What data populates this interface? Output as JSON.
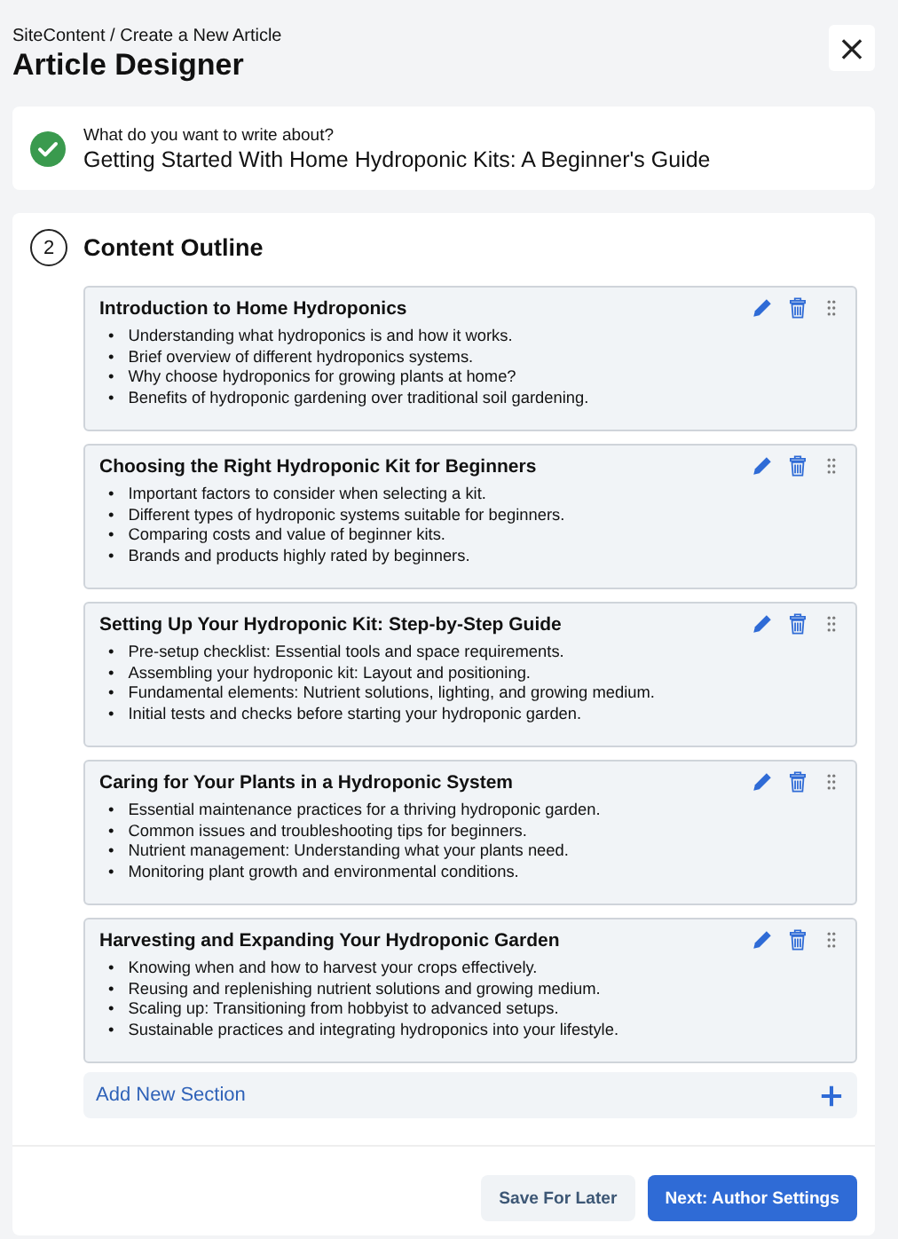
{
  "breadcrumb": "SiteContent / Create a New Article",
  "title": "Article Designer",
  "close_label": "×",
  "topic": {
    "done": true,
    "label": "What do you want to write about?",
    "value": "Getting Started With Home Hydroponic Kits: A Beginner's Guide"
  },
  "outline": {
    "step": "2",
    "title": "Content Outline",
    "sections": [
      {
        "title": "Introduction to Home Hydroponics",
        "points": [
          {
            "bullet": "•",
            "text": "Understanding what hydroponics is and how it works."
          },
          {
            "bullet": "•",
            "text": "Brief overview of different hydroponics systems."
          },
          {
            "bullet": "•",
            "text": "Why choose hydroponics for growing plants at home?"
          },
          {
            "bullet": "•",
            "text": "Benefits of hydroponic gardening over traditional soil gardening."
          }
        ]
      },
      {
        "title": "Choosing the Right Hydroponic Kit for Beginners",
        "points": [
          {
            "bullet": "•",
            "text": "Important factors to consider when selecting a kit."
          },
          {
            "bullet": "•",
            "text": "Different types of hydroponic systems suitable for beginners."
          },
          {
            "bullet": "•",
            "text": "Comparing costs and value of beginner kits."
          },
          {
            "bullet": "•",
            "text": "Brands and products highly rated by beginners."
          }
        ]
      },
      {
        "title": "Setting Up Your Hydroponic Kit: Step-by-Step Guide",
        "points": [
          {
            "bullet": "•",
            "text": "Pre-setup checklist: Essential tools and space requirements."
          },
          {
            "bullet": "•",
            "text": "Assembling your hydroponic kit: Layout and positioning."
          },
          {
            "bullet": "•",
            "text": "Fundamental elements: Nutrient solutions, lighting, and growing medium."
          },
          {
            "bullet": "•",
            "text": "Initial tests and checks before starting your hydroponic garden."
          }
        ]
      },
      {
        "title": "Caring for Your Plants in a Hydroponic System",
        "points": [
          {
            "bullet": "•",
            "text": "Essential maintenance practices for a thriving hydroponic garden."
          },
          {
            "bullet": "•",
            "text": "Common issues and troubleshooting tips for beginners."
          },
          {
            "bullet": "•",
            "text": "Nutrient management: Understanding what your plants need."
          },
          {
            "bullet": "•",
            "text": "Monitoring plant growth and environmental conditions."
          }
        ]
      },
      {
        "title": "Harvesting and Expanding Your Hydroponic Garden",
        "points": [
          {
            "bullet": "•",
            "text": "Knowing when and how to harvest your crops effectively."
          },
          {
            "bullet": "•",
            "text": "Reusing and replenishing nutrient solutions and growing medium."
          },
          {
            "bullet": "•",
            "text": "Scaling up: Transitioning from hobbyist to advanced setups."
          },
          {
            "bullet": "•",
            "text": "Sustainable practices and integrating hydroponics into your lifestyle."
          }
        ]
      }
    ],
    "add_label": "Add New Section"
  },
  "buttons": [
    {
      "label": "Save For Later",
      "kind": "secondary"
    },
    {
      "label": "Next: Author Settings",
      "kind": "primary"
    }
  ]
}
